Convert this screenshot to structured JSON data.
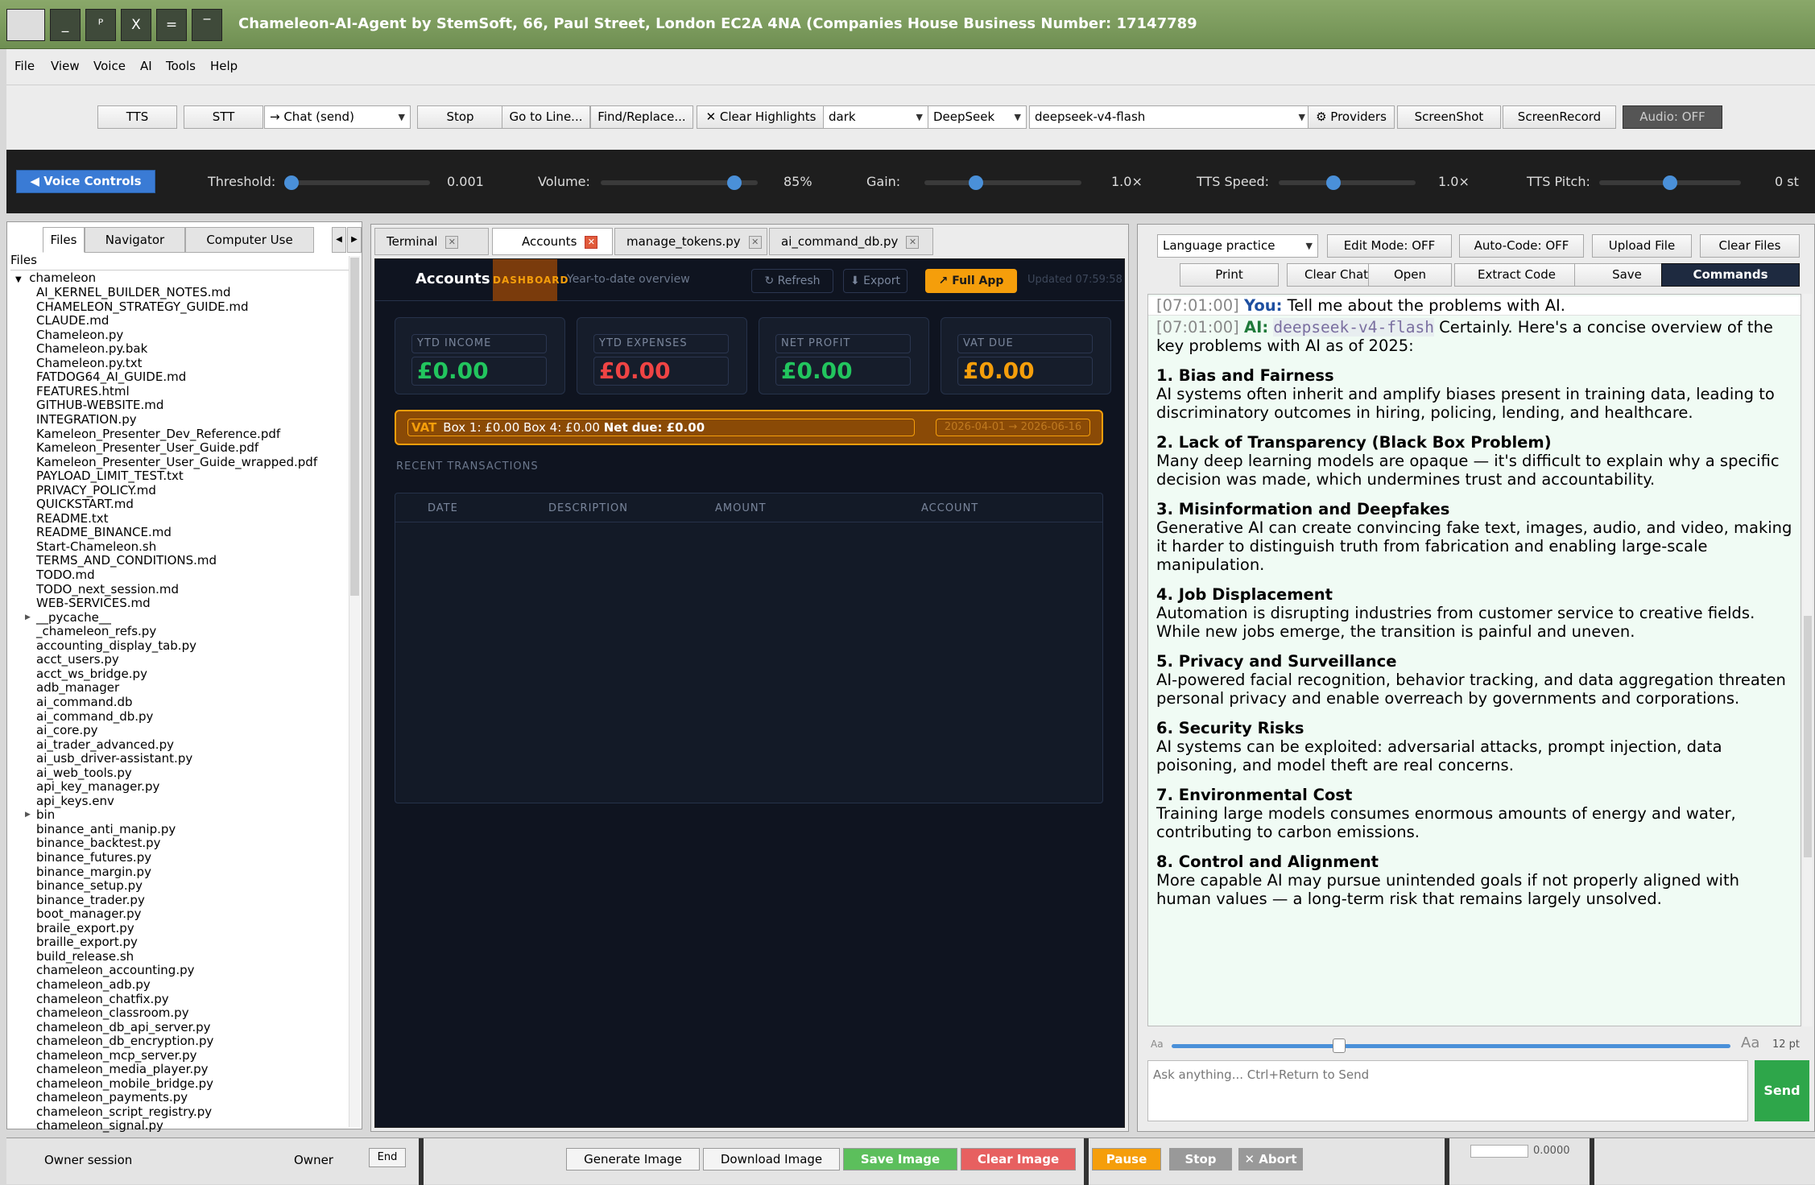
{
  "window": {
    "title": "Chameleon-AI-Agent by StemSoft, 66, Paul Street, London EC2A 4NA (Companies House Business Number: 17147789",
    "controls": [
      "_",
      "ᴾ",
      "X",
      "=",
      "‾"
    ]
  },
  "menu": [
    "File",
    "View",
    "Voice",
    "AI",
    "Tools",
    "Help"
  ],
  "toolbar": {
    "tts": "TTS",
    "stt": "STT",
    "send_mode": "→ Chat (send)",
    "stop": "Stop",
    "goto": "Go to Line...",
    "find": "Find/Replace...",
    "clear_highlights": "✕ Clear Highlights",
    "theme": "dark",
    "provider": "DeepSeek",
    "model": "deepseek-v4-flash",
    "providers": "⚙ Providers",
    "screenshot": "ScreenShot",
    "screenrecord": "ScreenRecord",
    "audio": "Audio: OFF"
  },
  "voice": {
    "button": "◀ Voice Controls",
    "threshold_label": "Threshold:",
    "threshold_value": "0.001",
    "threshold_level": 0.0,
    "volume_label": "Volume:",
    "volume_value": "85%",
    "volume_level": 0.85,
    "gain_label": "Gain:",
    "gain_value": "1.0×",
    "gain_level": 0.33,
    "tts_speed_label": "TTS Speed:",
    "tts_speed_value": "1.0×",
    "tts_speed_level": 0.4,
    "tts_pitch_label": "TTS Pitch:",
    "tts_pitch_value": "0 st",
    "tts_pitch_level": 0.5
  },
  "left": {
    "tabs": [
      "Files",
      "Navigator",
      "Computer Use"
    ],
    "header": "Files",
    "root": "chameleon",
    "files": [
      "AI_KERNEL_BUILDER_NOTES.md",
      "CHAMELEON_STRATEGY_GUIDE.md",
      "CLAUDE.md",
      "Chameleon.py",
      "Chameleon.py.bak",
      "Chameleon.py.txt",
      "FATDOG64_AI_GUIDE.md",
      "FEATURES.html",
      "GITHUB-WEBSITE.md",
      "INTEGRATION.py",
      "Kameleon_Presenter_Dev_Reference.pdf",
      "Kameleon_Presenter_User_Guide.pdf",
      "Kameleon_Presenter_User_Guide_wrapped.pdf",
      "PAYLOAD_LIMIT_TEST.txt",
      "PRIVACY_POLICY.md",
      "QUICKSTART.md",
      "README.txt",
      "README_BINANCE.md",
      "Start-Chameleon.sh",
      "TERMS_AND_CONDITIONS.md",
      "TODO.md",
      "TODO_next_session.md",
      "WEB-SERVICES.md",
      "__pycache__",
      "_chameleon_refs.py",
      "accounting_display_tab.py",
      "acct_users.py",
      "acct_ws_bridge.py",
      "adb_manager",
      "ai_command.db",
      "ai_command_db.py",
      "ai_core.py",
      "ai_trader_advanced.py",
      "ai_usb_driver-assistant.py",
      "ai_web_tools.py",
      "api_key_manager.py",
      "api_keys.env",
      "bin",
      "binance_anti_manip.py",
      "binance_backtest.py",
      "binance_futures.py",
      "binance_margin.py",
      "binance_setup.py",
      "binance_trader.py",
      "boot_manager.py",
      "braile_export.py",
      "braille_export.py",
      "build_release.sh",
      "chameleon_accounting.py",
      "chameleon_adb.py",
      "chameleon_chatfix.py",
      "chameleon_classroom.py",
      "chameleon_db_api_server.py",
      "chameleon_db_encryption.py",
      "chameleon_mcp_server.py",
      "chameleon_media_player.py",
      "chameleon_mobile_bridge.py",
      "chameleon_payments.py",
      "chameleon_script_registry.py",
      "chameleon_signal.py"
    ],
    "folders": [
      "__pycache__",
      "bin"
    ]
  },
  "center": {
    "tabs": [
      "Terminal",
      "Accounts",
      "manage_tokens.py",
      "ai_command_db.py"
    ],
    "dash": {
      "title": "Accounts",
      "badge": "DASHBOARD",
      "subtitle": "Year-to-date overview",
      "refresh": "↻ Refresh",
      "export": "⬇ Export",
      "full_app": "↗ Full App",
      "updated": "Updated 07:59:58",
      "cards": [
        {
          "label": "YTD INCOME",
          "value": "£0.00",
          "color": "#22c55e"
        },
        {
          "label": "YTD EXPENSES",
          "value": "£0.00",
          "color": "#ef4444"
        },
        {
          "label": "NET PROFIT",
          "value": "£0.00",
          "color": "#22c55e"
        },
        {
          "label": "VAT DUE",
          "value": "£0.00",
          "color": "#f59e0b"
        }
      ],
      "vat": {
        "tag": "VAT",
        "text": "Box 1: £0.00 Box 4: £0.00",
        "net": "Net due: £0.00",
        "period": "2026-04-01 → 2026-06-16"
      },
      "recent": "RECENT TRANSACTIONS",
      "cols": [
        "DATE",
        "DESCRIPTION",
        "AMOUNT",
        "ACCOUNT"
      ]
    }
  },
  "right": {
    "mode": "Language practice",
    "edit_mode": "Edit Mode: OFF",
    "auto_code": "Auto-Code: OFF",
    "upload": "Upload File",
    "clear_files": "Clear Files",
    "print": "Print",
    "clear_chat": "Clear Chat",
    "open": "Open",
    "extract": "Extract Code",
    "save": "Save",
    "commands": "Commands",
    "chat": {
      "t1": "[07:01:00]",
      "you": "You:",
      "q": "Tell me about the problems with AI.",
      "t2": "[07:01:00]",
      "ai": "AI:",
      "model": "deepseek-v4-flash",
      "intro": "Certainly. Here's a concise overview of the key problems with AI as of 2025:",
      "points": [
        {
          "h": "1. Bias and Fairness",
          "b": "AI systems often inherit and amplify biases present in training data, leading to discriminatory outcomes in hiring, policing, lending, and healthcare."
        },
        {
          "h": "2. Lack of Transparency (Black Box Problem)",
          "b": "Many deep learning models are opaque — it's difficult to explain why a specific decision was made, which undermines trust and accountability."
        },
        {
          "h": "3. Misinformation and Deepfakes",
          "b": "Generative AI can create convincing fake text, images, audio, and video, making it harder to distinguish truth from fabrication and enabling large-scale manipulation."
        },
        {
          "h": "4. Job Displacement",
          "b": "Automation is disrupting industries from customer service to creative fields. While new jobs emerge, the transition is painful and uneven."
        },
        {
          "h": "5. Privacy and Surveillance",
          "b": "AI-powered facial recognition, behavior tracking, and data aggregation threaten personal privacy and enable overreach by governments and corporations."
        },
        {
          "h": "6. Security Risks",
          "b": "AI systems can be exploited: adversarial attacks, prompt injection, data poisoning, and model theft are real concerns."
        },
        {
          "h": "7. Environmental Cost",
          "b": "Training large models consumes enormous amounts of energy and water, contributing to carbon emissions."
        },
        {
          "h": "8. Control and Alignment",
          "b": "More capable AI may pursue unintended goals if not properly aligned with human values — a long-term risk that remains largely unsolved."
        }
      ]
    },
    "font_small": "Aa",
    "font_large": "Aa",
    "font_size": "12 pt",
    "font_level": 0.3,
    "input_placeholder": "Ask anything... Ctrl+Return to Send",
    "send": "Send"
  },
  "bottom": {
    "session": "Owner session",
    "owner": "Owner",
    "end": "End",
    "gen_image": "Generate Image",
    "dl_image": "Download Image",
    "save_image": "Save Image",
    "clear_image": "Clear Image",
    "pause": "Pause",
    "stop": "Stop",
    "abort": "✕ Abort",
    "value": "0.0000"
  }
}
